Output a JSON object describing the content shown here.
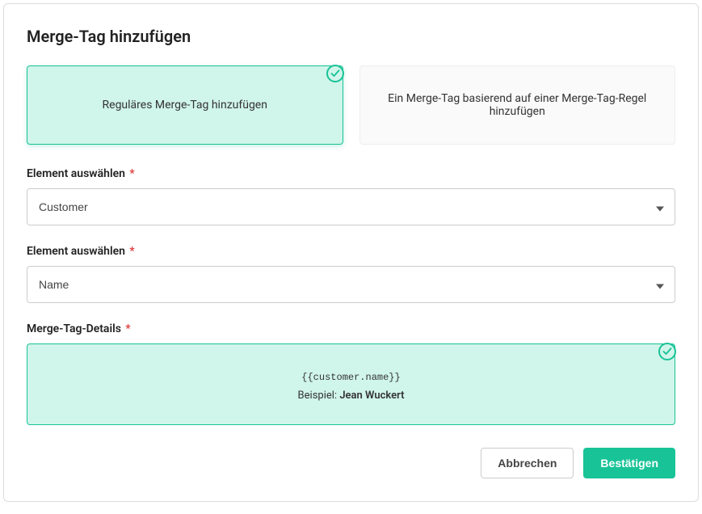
{
  "title": "Merge-Tag hinzufügen",
  "options": {
    "regular": "Reguläres Merge-Tag hinzufügen",
    "rule": "Ein Merge-Tag basierend auf einer Merge-Tag-Regel hinzufügen"
  },
  "form": {
    "select1_label": "Element auswählen",
    "select1_value": "Customer",
    "select2_label": "Element auswählen",
    "select2_value": "Name",
    "details_label": "Merge-Tag-Details",
    "merge_tag_code": "{{customer.name}}",
    "example_prefix": "Beispiel:",
    "example_value": "Jean Wuckert"
  },
  "buttons": {
    "cancel": "Abbrechen",
    "confirm": "Bestätigen"
  }
}
